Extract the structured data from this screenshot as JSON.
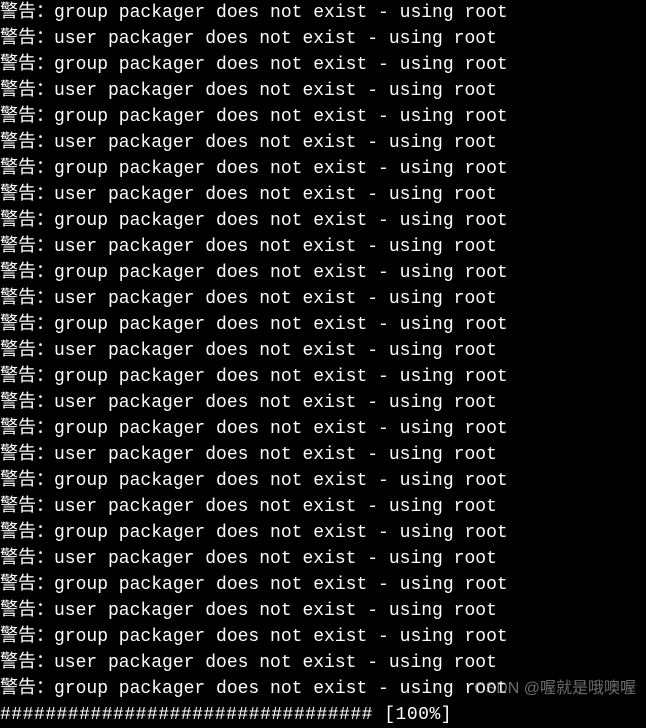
{
  "warning_prefix": "警告：",
  "group_msg": "group packager does not exist - using root",
  "user_msg": "user packager does not exist - using root",
  "lines": [
    {
      "type": "group"
    },
    {
      "type": "user"
    },
    {
      "type": "group"
    },
    {
      "type": "user"
    },
    {
      "type": "group"
    },
    {
      "type": "user"
    },
    {
      "type": "group"
    },
    {
      "type": "user"
    },
    {
      "type": "group"
    },
    {
      "type": "user"
    },
    {
      "type": "group"
    },
    {
      "type": "user"
    },
    {
      "type": "group"
    },
    {
      "type": "user"
    },
    {
      "type": "group"
    },
    {
      "type": "user"
    },
    {
      "type": "group"
    },
    {
      "type": "user"
    },
    {
      "type": "group"
    },
    {
      "type": "user"
    },
    {
      "type": "group"
    },
    {
      "type": "user"
    },
    {
      "type": "group"
    },
    {
      "type": "user"
    },
    {
      "type": "group"
    },
    {
      "type": "user"
    },
    {
      "type": "group"
    }
  ],
  "progress_bar": "################################# [100%]",
  "watermark": "CSDN @喔就是哦噢喔"
}
